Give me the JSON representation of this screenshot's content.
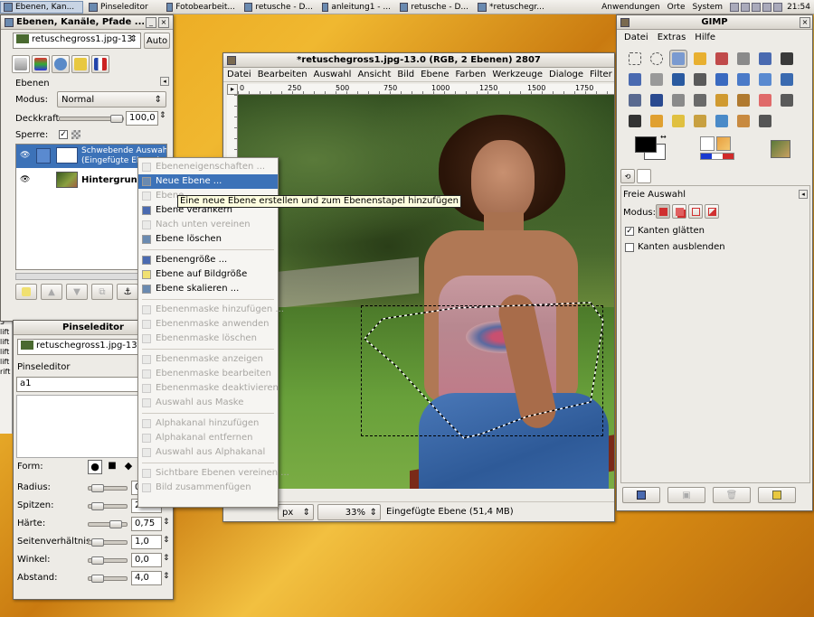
{
  "taskbar": {
    "tasks": [
      "Ebenen, Kan...",
      "Pinseleditor",
      "Fotobearbeit...",
      "retusche - D...",
      "anleitung1 - ...",
      "retusche - D...",
      "*retuschegr..."
    ],
    "menus": [
      "Anwendungen",
      "Orte",
      "System"
    ],
    "clock": "21:54"
  },
  "layers_dialog": {
    "title": "Ebenen, Kanäle, Pfade ...",
    "image_select": "retuschegross1.jpg-13",
    "auto_label": "Auto",
    "panel_title": "Ebenen",
    "modus_label": "Modus:",
    "modus_value": "Normal",
    "opacity_label": "Deckkraft:",
    "opacity_value": "100,0",
    "lock_label": "Sperre:",
    "layers": [
      {
        "name_line1": "Schwebende Auswahl",
        "name_line2": "(Eingefügte Ebene)"
      },
      {
        "name_line1": "Hintergrund"
      }
    ]
  },
  "left_strip_labels": [
    "lift",
    "lift",
    "lift",
    "lift",
    "lift",
    "lift",
    "lift",
    "lift",
    "ift 4",
    "ift 5",
    "lift",
    "lift",
    "lift",
    "lift",
    "rift"
  ],
  "brush_editor": {
    "title": "Pinseleditor",
    "image_select": "retuschegross1.jpg-13",
    "section_title": "Pinseleditor",
    "brush_name": "a1",
    "form_label": "Form:",
    "params": [
      {
        "label": "Radius:",
        "value": "0"
      },
      {
        "label": "Spitzen:",
        "value": "2"
      },
      {
        "label": "Härte:",
        "value": "0,75"
      },
      {
        "label": "Seitenverhältnis:",
        "value": "1,0"
      },
      {
        "label": "Winkel:",
        "value": "0,0"
      },
      {
        "label": "Abstand:",
        "value": "4,0"
      }
    ],
    "params_slider_fractions": [
      0.1,
      0.1,
      0.75,
      0.1,
      0.1,
      0.1
    ]
  },
  "image_window": {
    "title": "*retuschegross1.jpg-13.0 (RGB, 2 Ebenen) 2807",
    "menu": [
      "Datei",
      "Bearbeiten",
      "Auswahl",
      "Ansicht",
      "Bild",
      "Ebene",
      "Farben",
      "Werkzeuge",
      "Dialoge",
      "Filter",
      "Sk"
    ],
    "ruler_ticks": [
      "0",
      "250",
      "500",
      "750",
      "1000",
      "1250",
      "1500",
      "1750",
      "2000"
    ],
    "unit": "px",
    "zoom": "33%",
    "status": "Eingefügte Ebene (51,4 MB)"
  },
  "context_menu": {
    "tooltip": "Eine neue Ebene erstellen und zum Ebenenstapel hinzufügen",
    "items": [
      {
        "label": "Ebeneneigenschaften ...",
        "disabled": true,
        "highlighted": false
      },
      {
        "label": "Neue Ebene ...",
        "disabled": false,
        "highlighted": true
      },
      {
        "label": "Ebene",
        "disabled": true,
        "highlighted": false
      },
      {
        "label": "Ebene verankern",
        "disabled": false,
        "highlighted": false
      },
      {
        "label": "Nach unten vereinen",
        "disabled": true,
        "highlighted": false
      },
      {
        "label": "Ebene löschen",
        "disabled": false,
        "highlighted": false
      },
      {
        "sep": true
      },
      {
        "label": "Ebenengröße ...",
        "disabled": false,
        "highlighted": false
      },
      {
        "label": "Ebene auf Bildgröße",
        "disabled": false,
        "highlighted": false
      },
      {
        "label": "Ebene skalieren ...",
        "disabled": false,
        "highlighted": false
      },
      {
        "sep": true
      },
      {
        "label": "Ebenenmaske hinzufügen ...",
        "disabled": true,
        "highlighted": false
      },
      {
        "label": "Ebenenmaske anwenden",
        "disabled": true,
        "highlighted": false
      },
      {
        "label": "Ebenenmaske löschen",
        "disabled": true,
        "highlighted": false
      },
      {
        "sep": true
      },
      {
        "label": "Ebenenmaske anzeigen",
        "disabled": true,
        "highlighted": false
      },
      {
        "label": "Ebenenmaske bearbeiten",
        "disabled": true,
        "highlighted": false
      },
      {
        "label": "Ebenenmaske deaktivieren",
        "disabled": true,
        "highlighted": false
      },
      {
        "label": "Auswahl aus Maske",
        "disabled": true,
        "highlighted": false
      },
      {
        "sep": true
      },
      {
        "label": "Alphakanal hinzufügen",
        "disabled": true,
        "highlighted": false
      },
      {
        "label": "Alphakanal entfernen",
        "disabled": true,
        "highlighted": false
      },
      {
        "label": "Auswahl aus Alphakanal",
        "disabled": true,
        "highlighted": false
      },
      {
        "sep": true
      },
      {
        "label": "Sichtbare Ebenen vereinen ...",
        "disabled": true,
        "highlighted": false
      },
      {
        "label": "Bild zusammenfügen",
        "disabled": true,
        "highlighted": false
      }
    ]
  },
  "toolbox": {
    "title": "GIMP",
    "menu": [
      "Datei",
      "Extras",
      "Hilfe"
    ],
    "tool_icons": [
      "rect-select-icon",
      "ellipse-select-icon",
      "lasso-icon",
      "fuzzy-select-icon",
      "color-select-icon",
      "scissors-icon",
      "paths-icon",
      "color-picker-icon",
      "zoom-icon",
      "measure-icon",
      "move-icon",
      "crop-icon",
      "rotate-icon",
      "scale-icon",
      "shear-icon",
      "perspective-icon",
      "flip-icon",
      "text-icon",
      "bucket-fill-icon",
      "blend-icon",
      "pencil-icon",
      "paintbrush-icon",
      "eraser-icon",
      "airbrush-icon",
      "ink-icon",
      "heal-icon",
      "clone-icon",
      "perspective-clone-icon",
      "blur-icon",
      "smudge-icon",
      "dodge-icon"
    ],
    "fg_color": "#000000",
    "bg_color": "#ffffff",
    "options_title": "Freie Auswahl",
    "mode_label": "Modus:",
    "antialias_label": "Kanten glätten",
    "antialias_checked": true,
    "feather_label": "Kanten ausblenden",
    "feather_checked": false
  }
}
